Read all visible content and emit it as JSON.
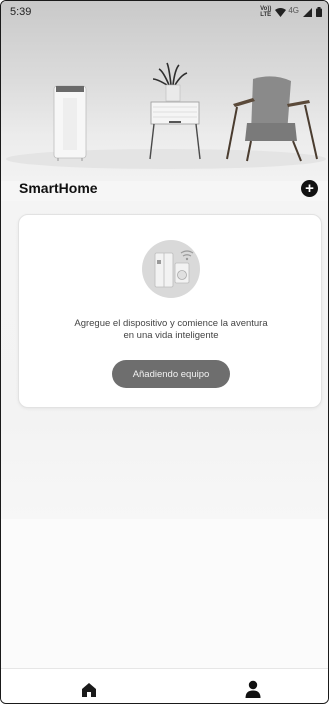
{
  "status_bar": {
    "time": "5:39",
    "volte_top": "Vo))",
    "volte_bottom": "LTE",
    "network": "4G",
    "icons": [
      "volte-icon",
      "wifi-icon",
      "signal-icon",
      "battery-icon"
    ]
  },
  "header": {
    "title": "SmartHome",
    "add_icon": "plus-circle-icon",
    "add_symbol": "+"
  },
  "empty_state": {
    "illustration": "smart-appliances-illustration",
    "line1": "Agregue el dispositivo y comience la aventura",
    "line2": "en una vida inteligente",
    "button_label": "Añadiendo equipo"
  },
  "bottom_nav": {
    "items": [
      {
        "icon": "home-icon",
        "active": true
      },
      {
        "icon": "profile-icon",
        "active": false
      }
    ]
  },
  "colors": {
    "button_bg": "#6e6e6e",
    "title_text": "#111111",
    "card_bg": "#ffffff"
  }
}
